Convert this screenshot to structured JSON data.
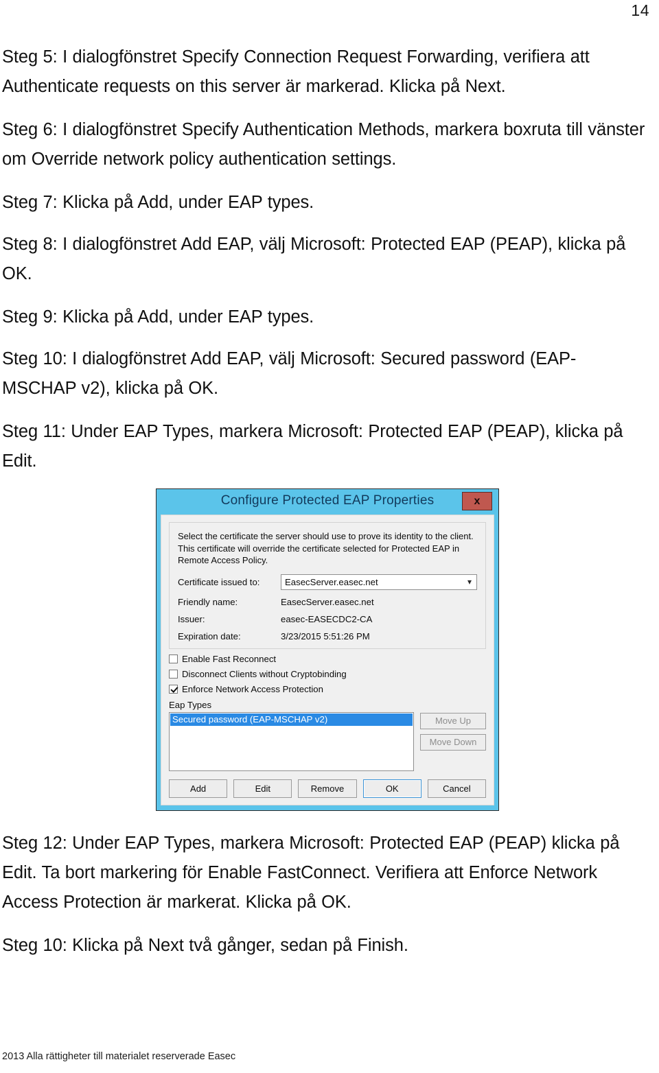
{
  "page": {
    "number": "14",
    "footer": "2013 Alla rättigheter till materialet reserverade Easec"
  },
  "steps": [
    {
      "id": "step-5",
      "text": "Steg 5: I dialogfönstret Specify Connection Request Forwarding, verifiera att Authenticate requests on this server är markerad. Klicka på Next."
    },
    {
      "id": "step-6",
      "text": "Steg 6: I dialogfönstret Specify Authentication Methods, markera boxruta till vänster om Override network policy authentication settings."
    },
    {
      "id": "step-7",
      "text": "Steg 7: Klicka på Add, under EAP types."
    },
    {
      "id": "step-8",
      "text": "Steg 8: I dialogfönstret Add EAP, välj Microsoft: Protected EAP (PEAP), klicka på OK."
    },
    {
      "id": "step-9",
      "text": "Steg 9: Klicka på Add, under EAP types."
    },
    {
      "id": "step-10",
      "text": "Steg 10: I dialogfönstret Add EAP, välj Microsoft: Secured password (EAP-MSCHAP v2), klicka på OK."
    },
    {
      "id": "step-11",
      "text": "Steg 11: Under EAP Types, markera Microsoft: Protected EAP (PEAP), klicka på Edit."
    }
  ],
  "steps_after": [
    {
      "id": "step-12",
      "text": "Steg 12: Under EAP Types, markera Microsoft: Protected EAP (PEAP) klicka på Edit. Ta bort markering för Enable FastConnect. Verifiera att Enforce Network Access Protection är markerat.  Klicka på OK."
    },
    {
      "id": "step-10b",
      "text": "Steg 10: Klicka på Next två gånger, sedan på Finish."
    }
  ],
  "dialog": {
    "title": "Configure Protected EAP Properties",
    "close_label": "x",
    "description": "Select the certificate the server should use to prove its identity to the client. This certificate will override the certificate selected for Protected EAP in Remote Access Policy.",
    "fields": [
      {
        "label": "Certificate issued to:",
        "value": "EasecServer.easec.net",
        "type": "combobox"
      },
      {
        "label": "Friendly name:",
        "value": "EasecServer.easec.net",
        "type": "text"
      },
      {
        "label": "Issuer:",
        "value": "easec-EASECDC2-CA",
        "type": "text"
      },
      {
        "label": "Expiration date:",
        "value": "3/23/2015 5:51:26 PM",
        "type": "text"
      }
    ],
    "checkboxes": [
      {
        "label": "Enable Fast Reconnect",
        "checked": false
      },
      {
        "label": "Disconnect Clients without Cryptobinding",
        "checked": false
      },
      {
        "label": "Enforce Network Access Protection",
        "checked": true
      }
    ],
    "eap_types_label": "Eap Types",
    "eap_types_items": [
      {
        "label": "Secured password (EAP-MSCHAP v2)",
        "selected": true
      }
    ],
    "side_buttons": [
      {
        "label": "Move Up",
        "disabled": true
      },
      {
        "label": "Move Down",
        "disabled": true
      }
    ],
    "bottom_buttons": [
      {
        "label": "Add",
        "default": false
      },
      {
        "label": "Edit",
        "default": false
      },
      {
        "label": "Remove",
        "default": false
      },
      {
        "label": "OK",
        "default": true
      },
      {
        "label": "Cancel",
        "default": false
      }
    ],
    "colors": {
      "titlebar": "#5bc4ea",
      "close_button": "#c0584f",
      "selection": "#2a8ae4",
      "dialog_face": "#f0f0f0"
    }
  }
}
